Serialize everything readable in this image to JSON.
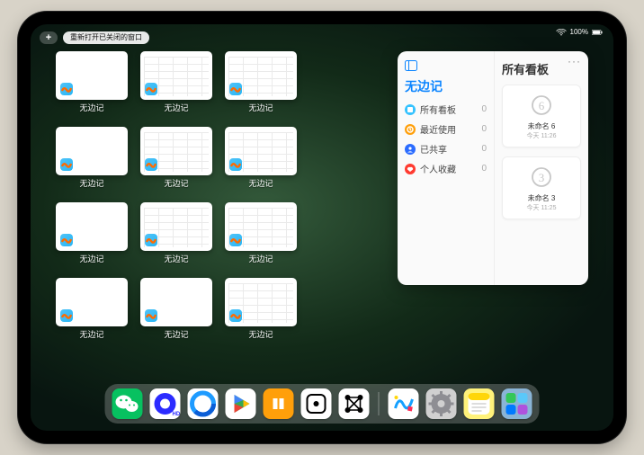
{
  "status": {
    "battery_pct": "100%"
  },
  "top_controls": {
    "plus": "+",
    "reopen_label": "重新打开已关闭的窗口"
  },
  "app_switcher": {
    "app_label": "无边记",
    "thumbnails": [
      {
        "kind": "white"
      },
      {
        "kind": "cal"
      },
      {
        "kind": "cal"
      },
      {
        "kind": "empty"
      },
      {
        "kind": "white"
      },
      {
        "kind": "cal"
      },
      {
        "kind": "cal"
      },
      {
        "kind": "empty"
      },
      {
        "kind": "white"
      },
      {
        "kind": "cal"
      },
      {
        "kind": "cal"
      },
      {
        "kind": "empty"
      },
      {
        "kind": "white"
      },
      {
        "kind": "white"
      },
      {
        "kind": "cal"
      },
      {
        "kind": "empty"
      }
    ]
  },
  "panel": {
    "left_title": "无边记",
    "right_title": "所有看板",
    "items": [
      {
        "label": "所有看板",
        "count": 0,
        "color": "#34c2ff"
      },
      {
        "label": "最近使用",
        "count": 0,
        "color": "#ff9f0a"
      },
      {
        "label": "已共享",
        "count": 0,
        "color": "#2b6cff"
      },
      {
        "label": "个人收藏",
        "count": 0,
        "color": "#ff3b30"
      }
    ],
    "boards": [
      {
        "name": "未命名 6",
        "date": "今天 11:26",
        "digit": "6"
      },
      {
        "name": "未命名 3",
        "date": "今天 11:25",
        "digit": "3"
      }
    ]
  },
  "dock": {
    "icons": [
      {
        "name": "wechat",
        "bg": "#07c160"
      },
      {
        "name": "quark",
        "bg": "#ffffff"
      },
      {
        "name": "qqbrowser",
        "bg": "#ffffff"
      },
      {
        "name": "play",
        "bg": "#ffffff"
      },
      {
        "name": "books",
        "bg": "#ff9f0a"
      },
      {
        "name": "dice",
        "bg": "#ffffff"
      },
      {
        "name": "graph",
        "bg": "#ffffff"
      },
      {
        "name": "freeform",
        "bg": "#ffffff"
      },
      {
        "name": "settings",
        "bg": "#d0d0d0"
      },
      {
        "name": "notes",
        "bg": "#fff27a"
      },
      {
        "name": "folder",
        "bg": "#8ab4d6"
      }
    ]
  }
}
